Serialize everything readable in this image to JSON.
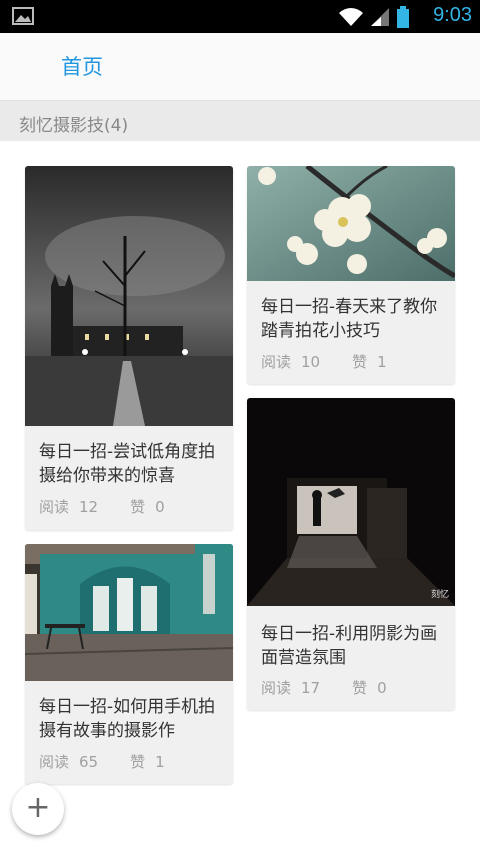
{
  "status": {
    "time": "9:03"
  },
  "appbar": {
    "title": "首页"
  },
  "section": {
    "label": "刻忆摄影技(4)"
  },
  "cards": [
    {
      "title": "每日一招-尝试低角度拍摄给你带来的惊喜",
      "read_label": "阅读",
      "reads": "12",
      "like_label": "赞",
      "likes": "0"
    },
    {
      "title": "每日一招-春天来了教你踏青拍花小技巧",
      "read_label": "阅读",
      "reads": "10",
      "like_label": "赞",
      "likes": "1"
    },
    {
      "title": "每日一招-如何用手机拍摄有故事的摄影作",
      "read_label": "阅读",
      "reads": "65",
      "like_label": "赞",
      "likes": "1"
    },
    {
      "title": "每日一招-利用阴影为画面营造氛围",
      "read_label": "阅读",
      "reads": "17",
      "like_label": "赞",
      "likes": "0",
      "watermark": "刻忆"
    }
  ],
  "fab": {
    "label": "+"
  },
  "colors": {
    "accent": "#2196e0",
    "status_time": "#33b5e5"
  }
}
